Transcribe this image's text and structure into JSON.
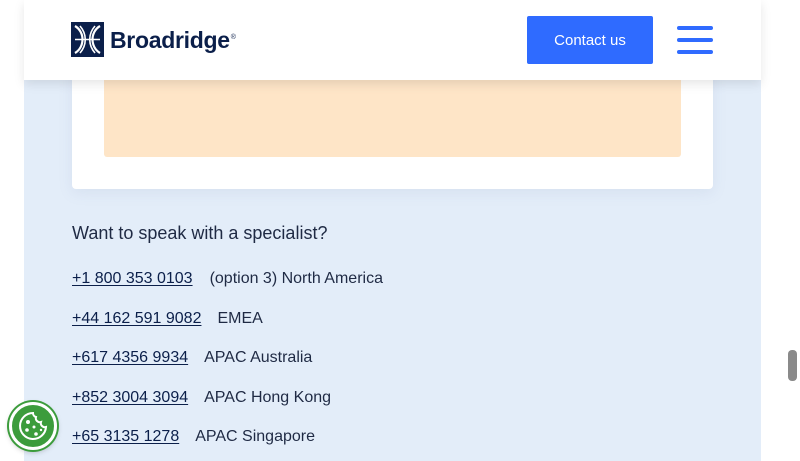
{
  "header": {
    "brand": "Broadridge",
    "brand_mark": "®",
    "contact_label": "Contact us",
    "menu_icon": "hamburger-menu-icon"
  },
  "contact": {
    "question": "Want to speak with a specialist?",
    "phones": [
      {
        "number": "+1 800 353 0103",
        "label": "(option 3) North America"
      },
      {
        "number": "+44 162 591 9082",
        "label": "EMEA"
      },
      {
        "number": "+617 4356 9934",
        "label": "APAC Australia"
      },
      {
        "number": "+852 3004 3094",
        "label": "APAC Hong Kong"
      },
      {
        "number": "+65 3135 1278",
        "label": "APAC Singapore"
      }
    ]
  },
  "colors": {
    "accent": "#2f6bff",
    "brand_navy": "#0b1f4a",
    "banner": "#fee5c7",
    "page_bg": "#e3edf9",
    "cookie": "#3c9c3c"
  },
  "icons": {
    "logo": "broadridge-logo-icon",
    "cookie": "cookie-icon"
  }
}
